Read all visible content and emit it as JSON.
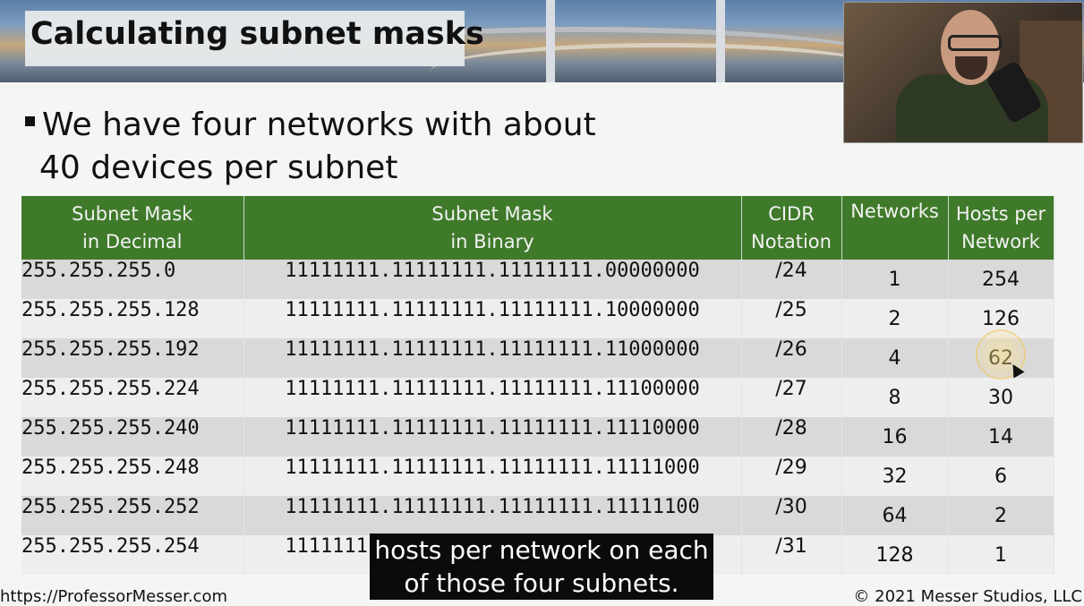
{
  "slide": {
    "title": "Calculating subnet masks",
    "bullet_line1": "We have four networks with about",
    "bullet_line2": "40 devices per subnet"
  },
  "table": {
    "headers": {
      "decimal_line1": "Subnet Mask",
      "decimal_line2": "in Decimal",
      "binary_line1": "Subnet Mask",
      "binary_line2": "in Binary",
      "cidr_line1": "CIDR",
      "cidr_line2": "Notation",
      "networks": "Networks",
      "hosts_line1": "Hosts per",
      "hosts_line2": "Network"
    },
    "rows": [
      {
        "decimal": "255.255.255.0",
        "binary": "11111111.11111111.11111111.00000000",
        "cidr": "/24",
        "networks": "1",
        "hosts": "254"
      },
      {
        "decimal": "255.255.255.128",
        "binary": "11111111.11111111.11111111.10000000",
        "cidr": "/25",
        "networks": "2",
        "hosts": "126"
      },
      {
        "decimal": "255.255.255.192",
        "binary": "11111111.11111111.11111111.11000000",
        "cidr": "/26",
        "networks": "4",
        "hosts": "62"
      },
      {
        "decimal": "255.255.255.224",
        "binary": "11111111.11111111.11111111.11100000",
        "cidr": "/27",
        "networks": "8",
        "hosts": "30"
      },
      {
        "decimal": "255.255.255.240",
        "binary": "11111111.11111111.11111111.11110000",
        "cidr": "/28",
        "networks": "16",
        "hosts": "14"
      },
      {
        "decimal": "255.255.255.248",
        "binary": "11111111.11111111.11111111.11111000",
        "cidr": "/29",
        "networks": "32",
        "hosts": "6"
      },
      {
        "decimal": "255.255.255.252",
        "binary": "11111111.11111111.11111111.11111100",
        "cidr": "/30",
        "networks": "64",
        "hosts": "2"
      },
      {
        "decimal": "255.255.255.254",
        "binary": "11111111.11111111.11111111.11111110",
        "cidr": "/31",
        "networks": "128",
        "hosts": "1"
      }
    ]
  },
  "caption": {
    "line1": "hosts per network on each",
    "line2": "of those four subnets."
  },
  "footer": {
    "left": "https://ProfessorMesser.com",
    "right": "© 2021 Messer Studios, LLC"
  },
  "colors": {
    "header_green": "#3f7a2a",
    "row_dark": "#d9d9d9",
    "row_light": "#eeeeee",
    "caption_bg": "#0b0b0b",
    "highlight": "#f0c85a"
  },
  "icons": {
    "cursor": "mouse-pointer-icon",
    "bullet": "square-bullet-icon"
  }
}
